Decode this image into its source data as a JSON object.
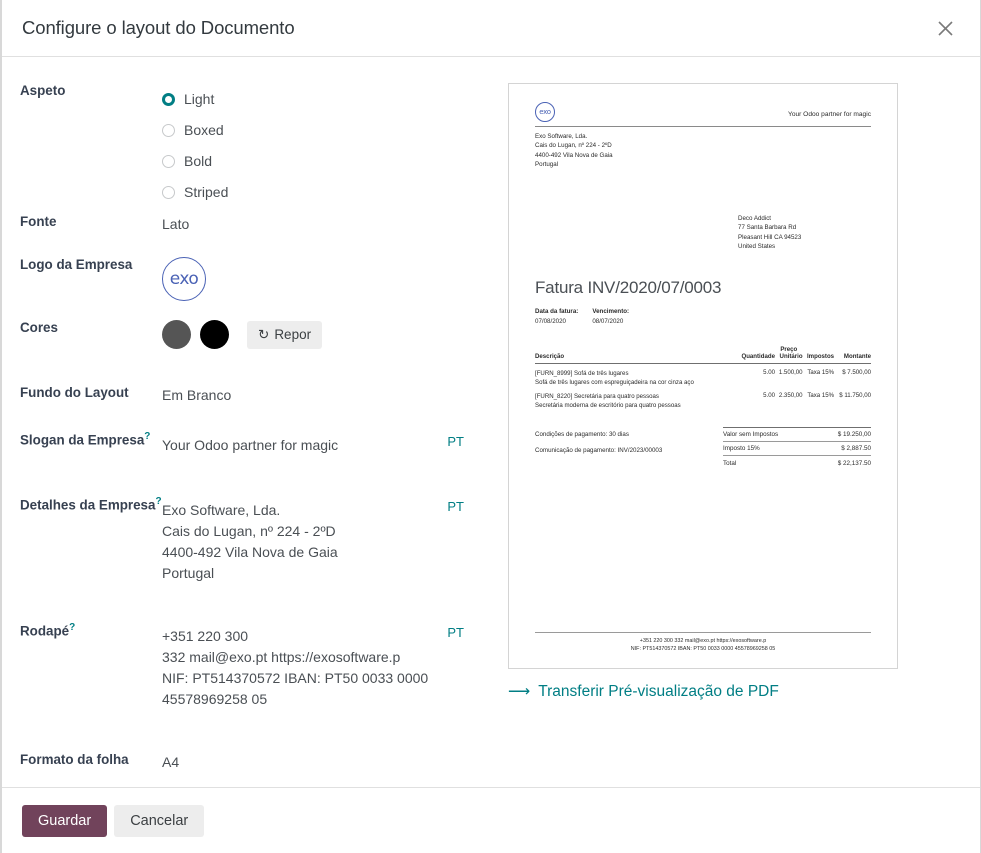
{
  "dialog": {
    "title": "Configure o layout do Documento",
    "close_label": "✕"
  },
  "form": {
    "aspect": {
      "label": "Aspeto",
      "options": [
        "Light",
        "Boxed",
        "Bold",
        "Striped"
      ],
      "selected": "Light"
    },
    "font": {
      "label": "Fonte",
      "value": "Lato"
    },
    "logo": {
      "label": "Logo da Empresa",
      "alt": "exo"
    },
    "colors": {
      "label": "Cores",
      "primary": "#555555",
      "secondary": "#000000",
      "reset_label": "Repor",
      "reset_icon": "refresh-icon"
    },
    "layout_background": {
      "label": "Fundo do Layout",
      "value": "Em Branco"
    },
    "company_tagline": {
      "label": "Slogan da Empresa",
      "help": "?",
      "value": "Your Odoo partner for magic",
      "lang": "PT"
    },
    "company_details": {
      "label": "Detalhes da Empresa",
      "help": "?",
      "lines": [
        "Exo Software, Lda.",
        "Cais do Lugan, nº 224 - 2ºD",
        "4400-492 Vila Nova de Gaia",
        "Portugal"
      ],
      "lang": "PT"
    },
    "footer": {
      "label": "Rodapé",
      "help": "?",
      "lines": [
        "+351 220 300",
        "332 mail@exo.pt https://exosoftware.p",
        "NIF: PT514370572 IBAN: PT50 0033 0000",
        "45578969258 05"
      ],
      "lang": "PT"
    },
    "paper_format": {
      "label": "Formato da folha",
      "value": "A4"
    }
  },
  "preview": {
    "logo_text": "exo",
    "slogan": "Your Odoo partner for magic",
    "company_address": [
      "Exo Software, Lda.",
      "Cais do Lugan, nº 224 - 2ºD",
      "4400-492 Vila Nova de Gaia",
      "Portugal"
    ],
    "customer_address": [
      "Deco Addict",
      "77 Santa Barbara Rd",
      "Pleasant Hill CA 94523",
      "United States"
    ],
    "invoice_title": "Fatura INV/2020/07/0003",
    "dates": [
      {
        "label": "Data da fatura:",
        "value": "07/08/2020"
      },
      {
        "label": "Vencimento:",
        "value": "08/07/2020"
      }
    ],
    "table": {
      "headers": {
        "description": "Descrição",
        "quantity": "Quantidade",
        "price_top": "Preço",
        "price_bottom": "Unitário",
        "taxes": "Impostos",
        "amount": "Montante"
      },
      "rows": [
        {
          "description": "[FURN_8999] Sofá de três lugares",
          "sub": "Sofá de três lugares com espreguiçadeira na cor cinza aço",
          "quantity": "5.00",
          "unit_price": "1.500,00",
          "taxes": "Taxa 15%",
          "amount": "$ 7.500,00"
        },
        {
          "description": "[FURN_8220] Secretária para quatro pessoas",
          "sub": "Secretária moderna de escritório para quatro pessoas",
          "quantity": "5.00",
          "unit_price": "2.350,00",
          "taxes": "Taxa 15%",
          "amount": "$ 11.750,00"
        }
      ]
    },
    "payment_terms": "Condições de pagamento: 30 dias",
    "payment_communication": "Comunicação de pagamento: INV/2023/00003",
    "totals": [
      {
        "label": "Valor sem Impostos",
        "value": "$ 19.250,00"
      },
      {
        "label": "Imposto 15%",
        "value": "$ 2,887.50"
      },
      {
        "label": "Total",
        "value": "$ 22,137.50"
      }
    ],
    "footer_lines": [
      "+351 220 300 332 mail@exo.pt https://exosoftware.p",
      "NIF: PT514370572 IBAN: PT50 0033 0000 45578969258 05"
    ],
    "download_link": "Transferir Pré-visualização de PDF",
    "download_icon": "arrow-right-icon"
  },
  "actions": {
    "save": "Guardar",
    "cancel": "Cancelar",
    "save_color": "#71435b"
  }
}
